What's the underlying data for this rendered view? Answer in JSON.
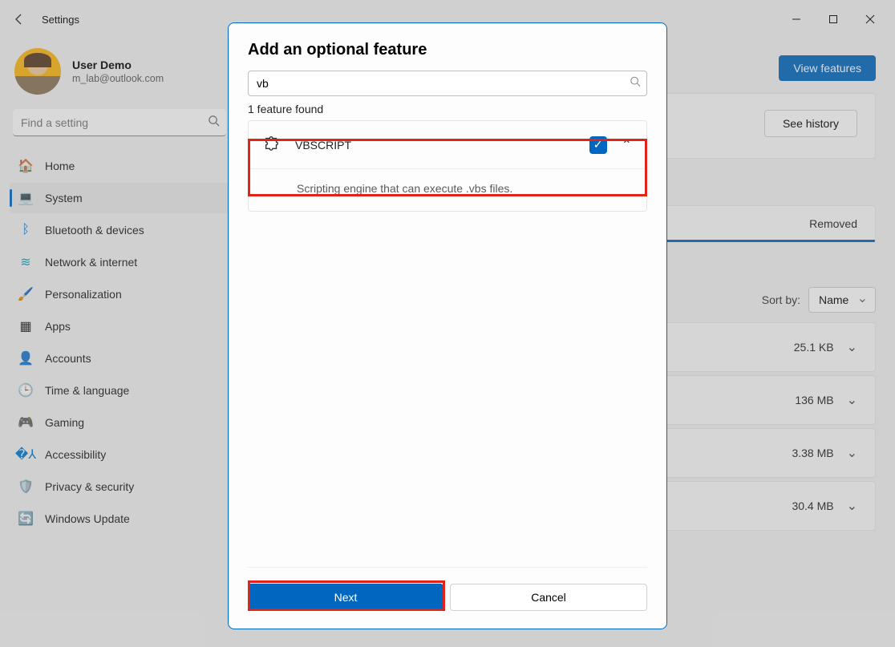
{
  "window": {
    "title": "Settings"
  },
  "profile": {
    "name": "User Demo",
    "email": "m_lab@outlook.com"
  },
  "search": {
    "placeholder": "Find a setting"
  },
  "nav": [
    {
      "label": "Home"
    },
    {
      "label": "System"
    },
    {
      "label": "Bluetooth & devices"
    },
    {
      "label": "Network & internet"
    },
    {
      "label": "Personalization"
    },
    {
      "label": "Apps"
    },
    {
      "label": "Accounts"
    },
    {
      "label": "Time & language"
    },
    {
      "label": "Gaming"
    },
    {
      "label": "Accessibility"
    },
    {
      "label": "Privacy & security"
    },
    {
      "label": "Windows Update"
    }
  ],
  "content": {
    "view_features": "View features",
    "see_history": "See history",
    "removed": "Removed",
    "sort_label": "Sort by:",
    "sort_value": "Name",
    "rows": [
      {
        "size": "25.1 KB"
      },
      {
        "size": "136 MB"
      },
      {
        "size": "3.38 MB"
      },
      {
        "size": "30.4 MB"
      }
    ]
  },
  "modal": {
    "title": "Add an optional feature",
    "search_value": "vb",
    "found": "1 feature found",
    "feature_name": "VBSCRIPT",
    "feature_desc": "Scripting engine that can execute .vbs files.",
    "next": "Next",
    "cancel": "Cancel"
  }
}
